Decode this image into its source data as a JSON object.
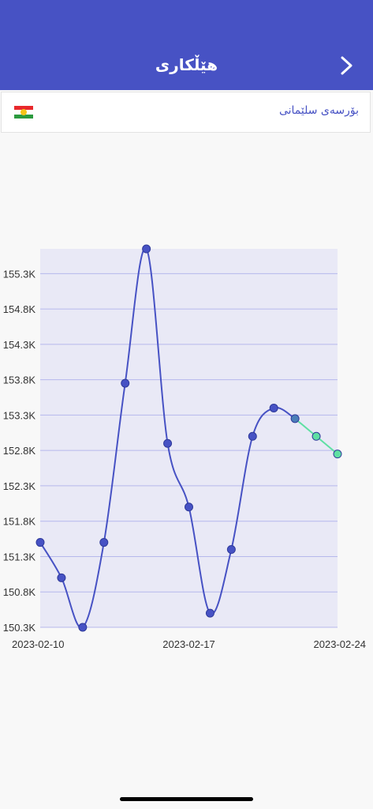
{
  "header": {
    "title": "هێڵکاری",
    "back_icon": "chevron-right-icon",
    "background": "#4752c4"
  },
  "market": {
    "name": "بۆرسەی سلێمانی",
    "flag_icon": "kurdistan-flag-icon",
    "flag_colors": [
      "#e8282c",
      "#ffffff",
      "#2b9a3e",
      "#f5c518"
    ]
  },
  "chart_data": {
    "type": "line",
    "title": "",
    "xlabel": "",
    "ylabel": "",
    "x": [
      "2023-02-10",
      "2023-02-11",
      "2023-02-12",
      "2023-02-13",
      "2023-02-14",
      "2023-02-15",
      "2023-02-16",
      "2023-02-17",
      "2023-02-18",
      "2023-02-19",
      "2023-02-20",
      "2023-02-21",
      "2023-02-22",
      "2023-02-23",
      "2023-02-24"
    ],
    "series": [
      {
        "values": [
          151.5,
          151.0,
          150.3,
          151.5,
          153.75,
          155.65,
          152.9,
          152.0,
          150.5,
          151.4,
          153.0,
          153.4,
          153.25,
          153.0,
          152.75
        ],
        "color": "#4752c4",
        "forecast_from_index": 12,
        "forecast_color": "#5fe0a3"
      }
    ],
    "ylim": [
      150.3,
      155.65
    ],
    "yticks": [
      150.3,
      150.8,
      151.3,
      151.8,
      152.3,
      152.8,
      153.3,
      153.8,
      154.3,
      154.8,
      155.3
    ],
    "ytick_labels": [
      "150.3K",
      "150.8K",
      "151.3K",
      "151.8K",
      "152.3K",
      "152.8K",
      "153.3K",
      "153.8K",
      "154.3K",
      "154.8K",
      "155.3K"
    ],
    "xtick_labels": [
      "2023-02-10",
      "2023-02-17",
      "2023-02-24"
    ],
    "xtick_indices": [
      0,
      7,
      14
    ],
    "plot_background": "#e9e9f6",
    "grid_color": "#b6b8ec",
    "grid": true
  }
}
